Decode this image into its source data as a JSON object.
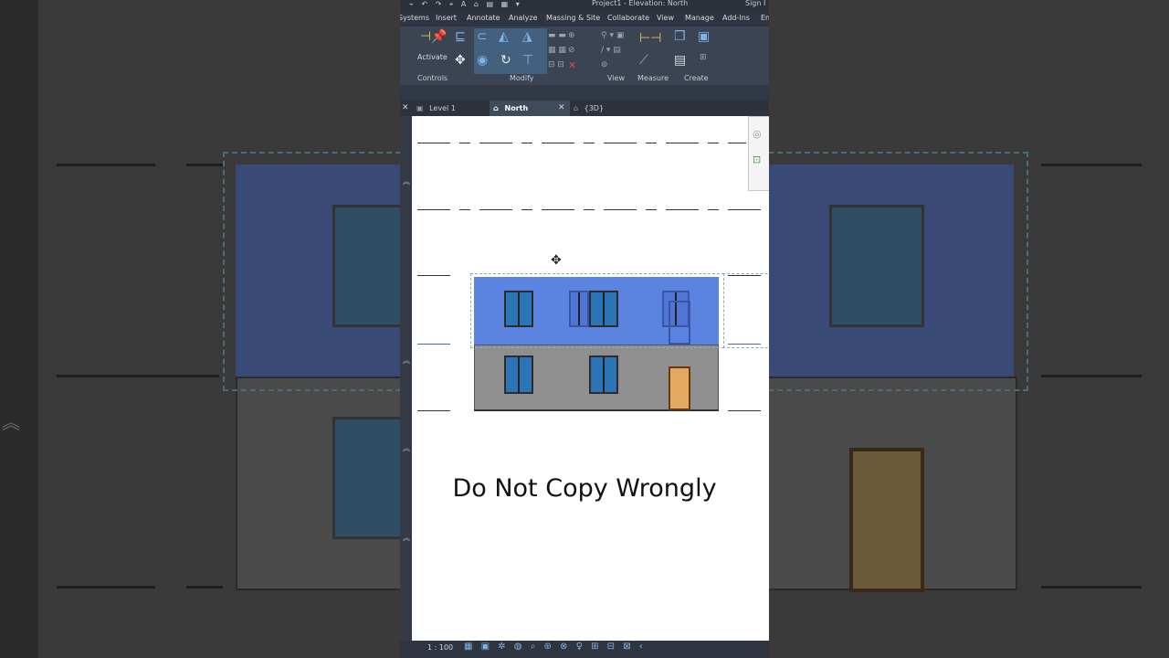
{
  "window": {
    "title": "Project1 - Elevation: North",
    "sign_in": "Sign I"
  },
  "menu": [
    "Systems",
    "Insert",
    "Annotate",
    "Analyze",
    "Massing & Site",
    "Collaborate",
    "View",
    "Manage",
    "Add-Ins",
    "En"
  ],
  "ribbon": {
    "activate_label": "Activate",
    "groups": [
      "Controls",
      "Modify",
      "View",
      "Measure",
      "Create"
    ],
    "icons": [
      "pin-icon",
      "align-icon",
      "offset-icon",
      "mirror-axis-icon",
      "mirror-draw-icon",
      "move-icon",
      "copy-icon",
      "rotate-icon",
      "trim-icon",
      "delete-icon",
      "measure-icon",
      "create-part-icon"
    ]
  },
  "tabs": [
    {
      "label": "Level 1",
      "active": false
    },
    {
      "label": "North",
      "active": true
    },
    {
      "label": "{3D}",
      "active": false
    }
  ],
  "caption": "Do Not Copy Wrongly",
  "status": {
    "scale": "1 : 100"
  },
  "colors": {
    "selection_blue": "#5b84e0",
    "wall_grey": "#8f8f8f",
    "window_glass": "#2b74b8",
    "door_wood": "#e3a95e",
    "ui_dark": "#3b4453"
  }
}
